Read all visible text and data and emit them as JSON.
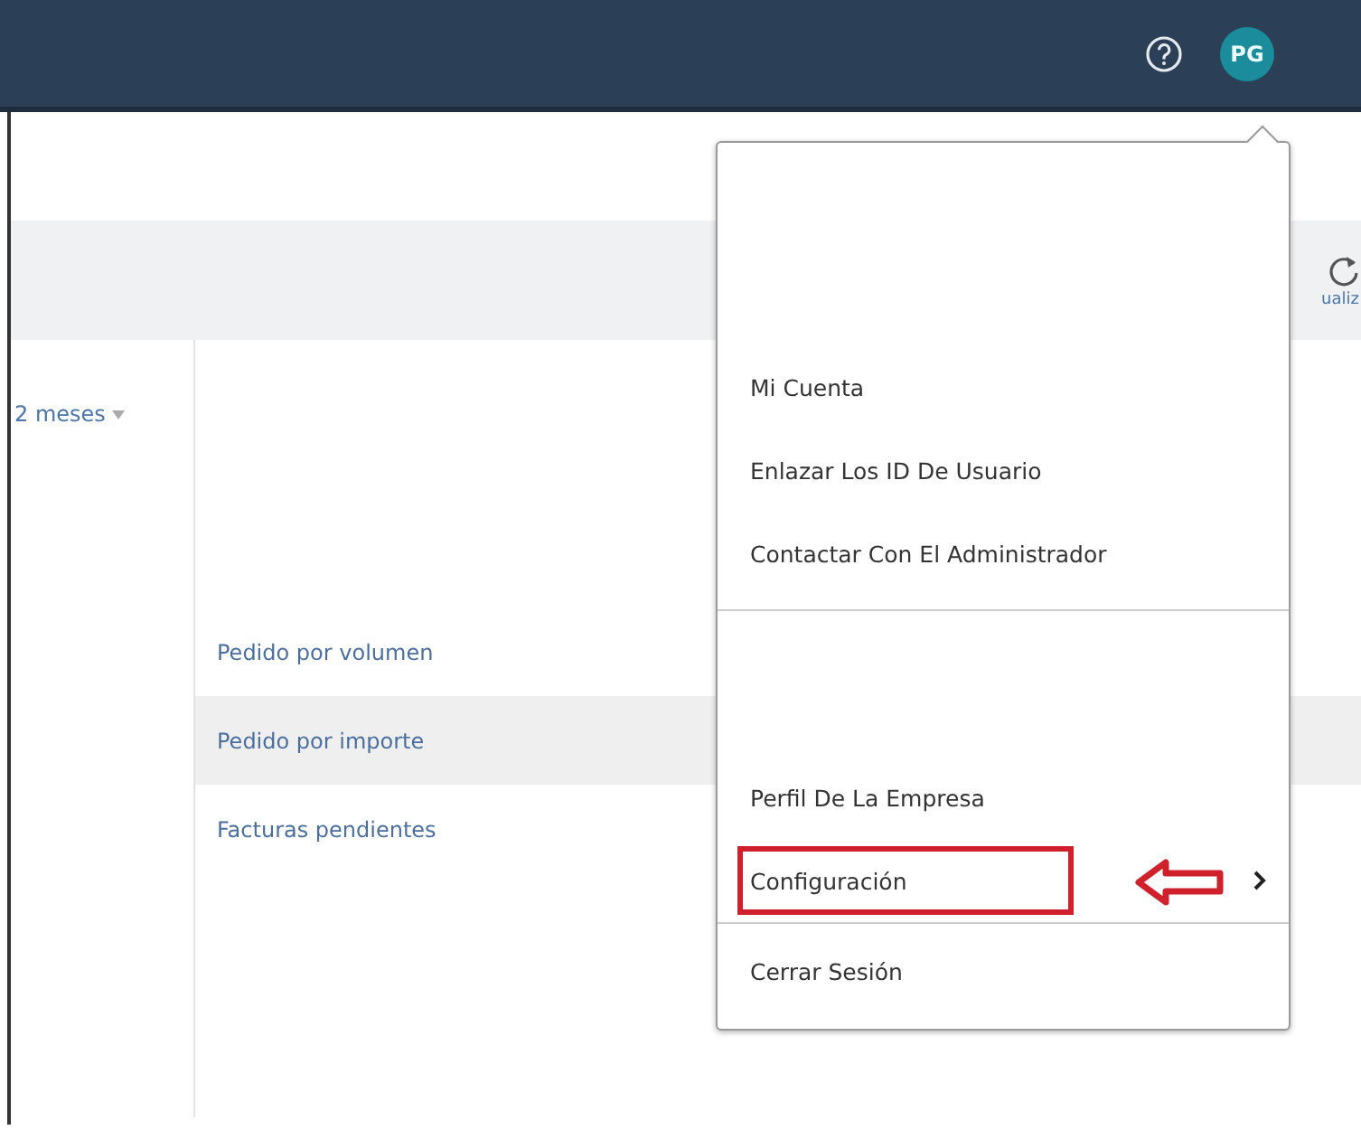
{
  "top_bar": {
    "avatar": "PG"
  },
  "toolbar": {
    "refresh_label": "ualiz"
  },
  "filter": {
    "label": "2 meses"
  },
  "list": [
    {
      "label": "Pedido por volumen",
      "selected": false
    },
    {
      "label": "Pedido por importe",
      "selected": true
    },
    {
      "label": "Facturas pendientes",
      "selected": false
    }
  ],
  "user_menu": {
    "sections": [
      {
        "items": [
          {
            "label": "Mi Cuenta",
            "submenu": false,
            "annotated": false
          },
          {
            "label": "Enlazar Los ID De Usuario",
            "submenu": false,
            "annotated": false
          },
          {
            "label": "Contactar Con El Administrador",
            "submenu": false,
            "annotated": false
          }
        ]
      },
      {
        "items": [
          {
            "label": "Perfil De La Empresa",
            "submenu": false,
            "annotated": false
          },
          {
            "label": "Configuración",
            "submenu": true,
            "annotated": true
          }
        ]
      },
      {
        "items": [
          {
            "label": "Cerrar Sesión",
            "submenu": false,
            "annotated": false
          }
        ]
      }
    ]
  }
}
